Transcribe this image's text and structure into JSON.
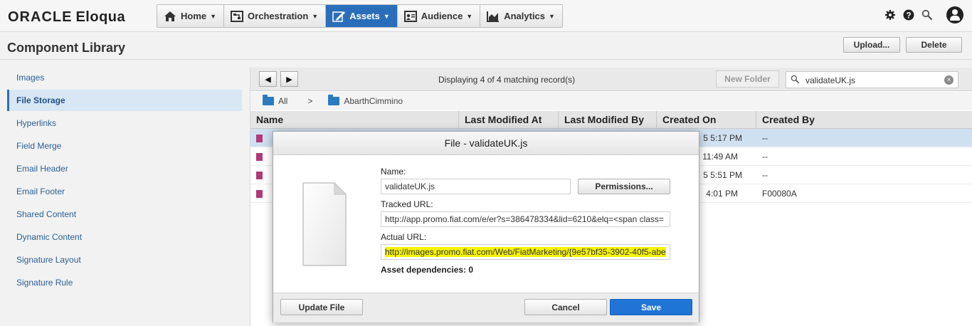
{
  "app": {
    "logo_oracle": "ORACLE",
    "logo_eloqua": "Eloqua"
  },
  "nav": [
    {
      "label": "Home",
      "icon": "home-icon"
    },
    {
      "label": "Orchestration",
      "icon": "orchestration-icon"
    },
    {
      "label": "Assets",
      "icon": "assets-icon",
      "active": true
    },
    {
      "label": "Audience",
      "icon": "audience-icon"
    },
    {
      "label": "Analytics",
      "icon": "analytics-icon"
    }
  ],
  "page": {
    "title": "Component Library",
    "upload_label": "Upload...",
    "delete_label": "Delete"
  },
  "sidebar": {
    "items": [
      {
        "label": "Images"
      },
      {
        "label": "File Storage",
        "active": true
      },
      {
        "label": "Hyperlinks"
      },
      {
        "label": "Field Merge"
      },
      {
        "label": "Email Header"
      },
      {
        "label": "Email Footer"
      },
      {
        "label": "Shared Content"
      },
      {
        "label": "Dynamic Content"
      },
      {
        "label": "Signature Layout"
      },
      {
        "label": "Signature Rule"
      }
    ]
  },
  "toolbar": {
    "prev": "◀",
    "next": "▶",
    "record_info": "Displaying 4 of 4 matching record(s)",
    "new_folder": "New Folder",
    "search_value": "validateUK.js"
  },
  "breadcrumb": {
    "root": "All",
    "separator": ">",
    "folder": "AbarthCimmino"
  },
  "table": {
    "columns": [
      "Name",
      "Last Modified At",
      "Last Modified By",
      "Created On",
      "Created By"
    ],
    "rows": [
      {
        "created_on": "5 5:17 PM",
        "created_by": "--"
      },
      {
        "created_on": "11:49 AM",
        "created_by": "--"
      },
      {
        "created_on": "5 5:51 PM",
        "created_by": "--"
      },
      {
        "created_on": "4:01 PM",
        "created_by": "F00080A"
      }
    ]
  },
  "dialog": {
    "title": "File - validateUK.js",
    "name_label": "Name:",
    "name_value": "validateUK.js",
    "permissions_label": "Permissions...",
    "tracked_label": "Tracked URL:",
    "tracked_value": "http://app.promo.fiat.com/e/er?s=386478334&lid=6210&elq=<span class=",
    "actual_label": "Actual URL:",
    "actual_value": "http://images.promo.fiat.com/Web/FiatMarketing/{9e57bf35-3902-40f5-abe",
    "dependencies": "Asset dependencies: 0",
    "update_label": "Update File",
    "cancel_label": "Cancel",
    "save_label": "Save"
  },
  "colors": {
    "accent": "#2a6ebb",
    "save_button": "#1f74d6",
    "highlight": "#f6f300",
    "file_icon": "#b0397a"
  }
}
